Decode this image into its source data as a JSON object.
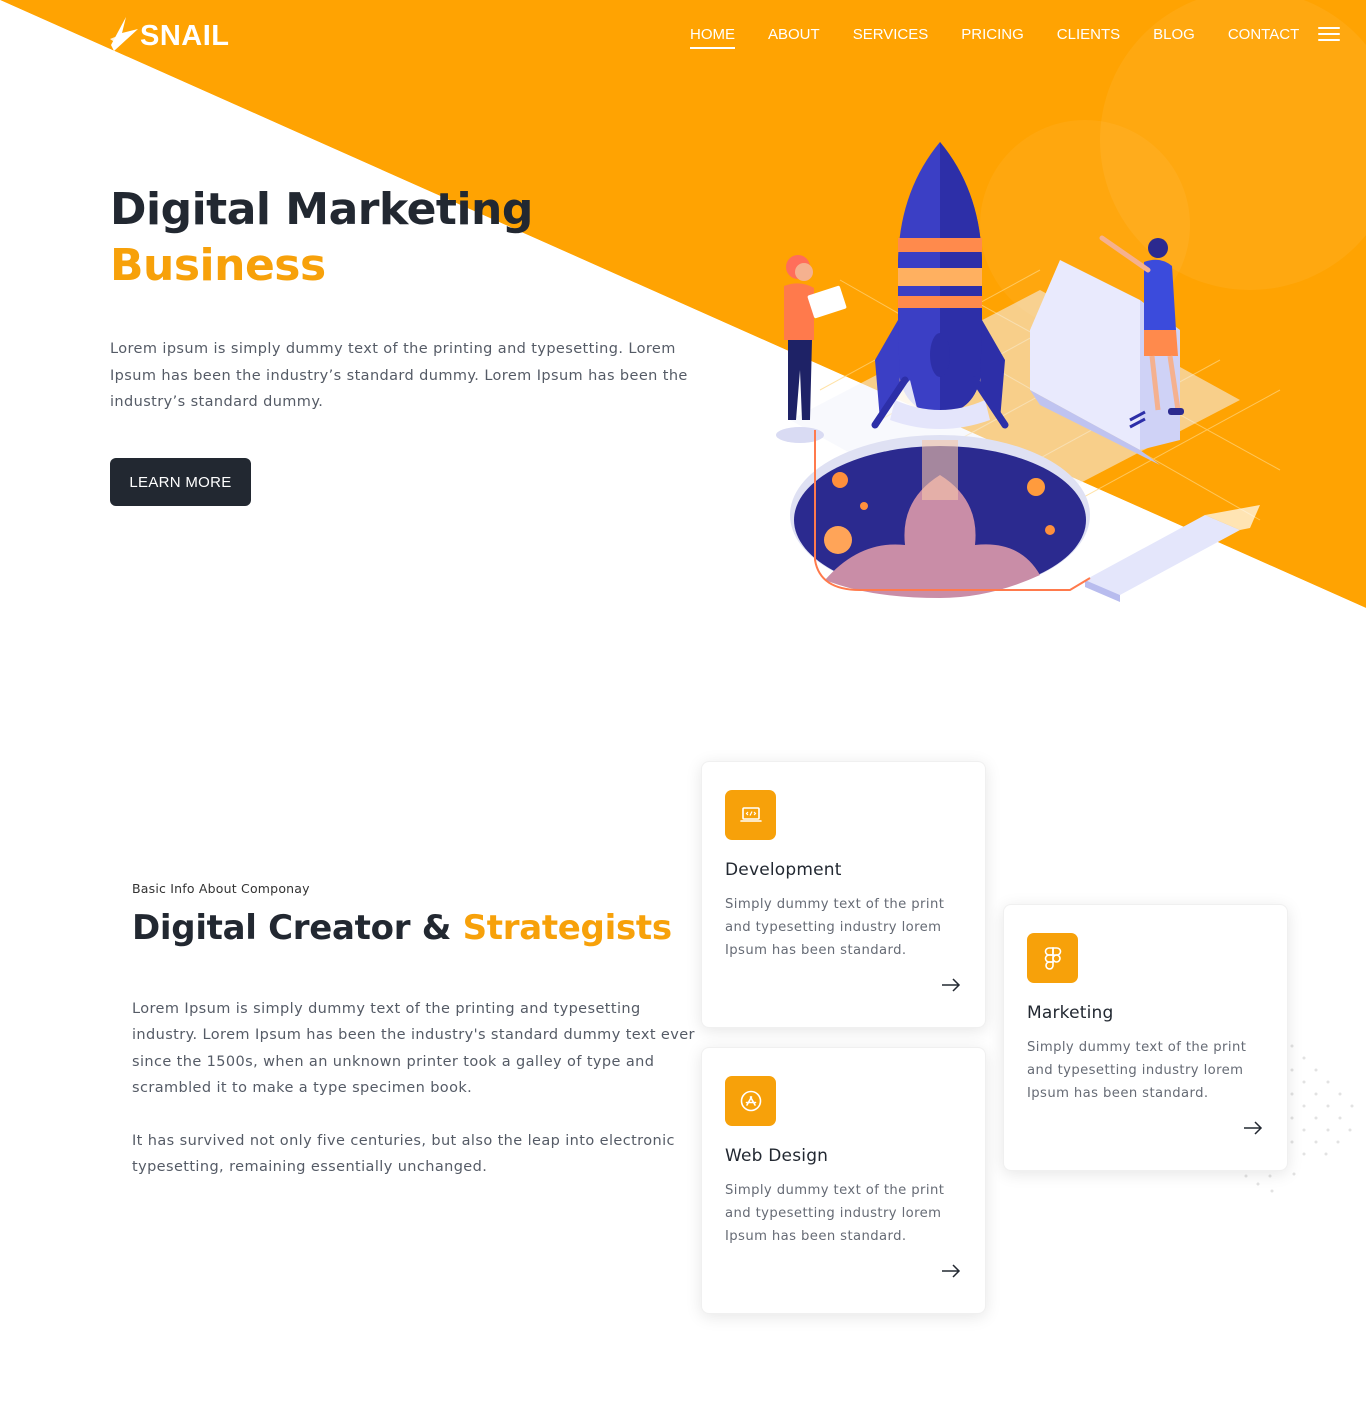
{
  "brand": {
    "name": "SNAIL",
    "accent": "#f7a10a",
    "dark": "#222831"
  },
  "nav": {
    "items": [
      "HOME",
      "ABOUT",
      "SERVICES",
      "PRICING",
      "CLIENTS",
      "BLOG",
      "CONTACT"
    ],
    "active": "HOME",
    "menu_icon": "hamburger-menu-icon"
  },
  "hero": {
    "title_line1": "Digital Marketing",
    "title_line2": "Business",
    "description": "Lorem ipsum is simply dummy text of the printing and typesetting. Lorem Ipsum has been the industry’s standard dummy. Lorem Ipsum has been the industry’s standard dummy.",
    "cta_label": "LEARN MORE",
    "illustration": "rocket-launch-illustration"
  },
  "about": {
    "kicker": "Basic Info About Componay",
    "title_main": "Digital Creator & ",
    "title_accent": "Strategists",
    "paragraph1": "Lorem Ipsum is simply dummy text of the printing and typesetting industry. Lorem Ipsum has been the industry's standard dummy text ever since the 1500s, when an unknown printer took a galley of type and scrambled it to make a type specimen book.",
    "paragraph2": "It has survived not only five centuries, but also the leap into electronic typesetting, remaining essentially unchanged."
  },
  "services": [
    {
      "title": "Development",
      "text": "Simply dummy text of the print and typesetting industry lorem Ipsum has been standard.",
      "icon": "laptop-code-icon"
    },
    {
      "title": "Marketing",
      "text": "Simply dummy text of the print and typesetting industry lorem Ipsum has been standard.",
      "icon": "figma-icon"
    },
    {
      "title": "Web Design",
      "text": "Simply dummy text of the print and typesetting industry lorem Ipsum has been standard.",
      "icon": "app-store-icon"
    }
  ]
}
